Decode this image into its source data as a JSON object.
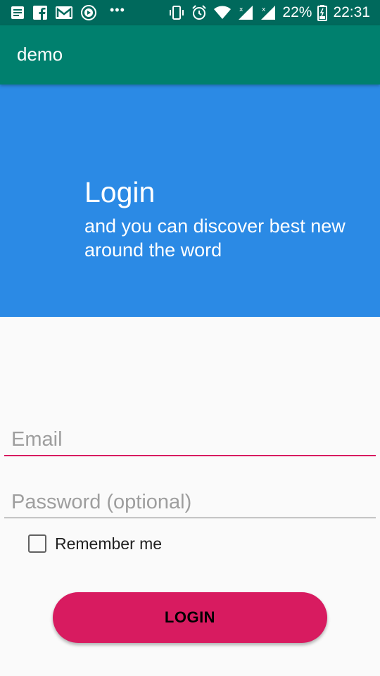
{
  "statusbar": {
    "battery_percent": "22%",
    "time": "22:31",
    "left_icons": [
      "notes-icon",
      "facebook-icon",
      "gmail-icon",
      "media-icon",
      "more-dots-icon"
    ],
    "right_icons": [
      "vibrate-icon",
      "alarm-icon",
      "wifi-icon",
      "signal-icon",
      "signal-icon-2",
      "battery-icon"
    ]
  },
  "appbar": {
    "title": "demo"
  },
  "hero": {
    "title": "Login",
    "subtitle": "and you can discover best new around the word"
  },
  "form": {
    "email": {
      "placeholder": "Email",
      "value": ""
    },
    "password": {
      "placeholder": "Password (optional)",
      "value": ""
    },
    "remember_label": "Remember me",
    "remember_checked": false,
    "login_label": "LOGIN"
  },
  "colors": {
    "statusbar_bg": "#00695c",
    "appbar_bg": "#00806e",
    "hero_bg": "#2b8ae5",
    "accent": "#d81b60",
    "page_bg": "#fafafa"
  }
}
